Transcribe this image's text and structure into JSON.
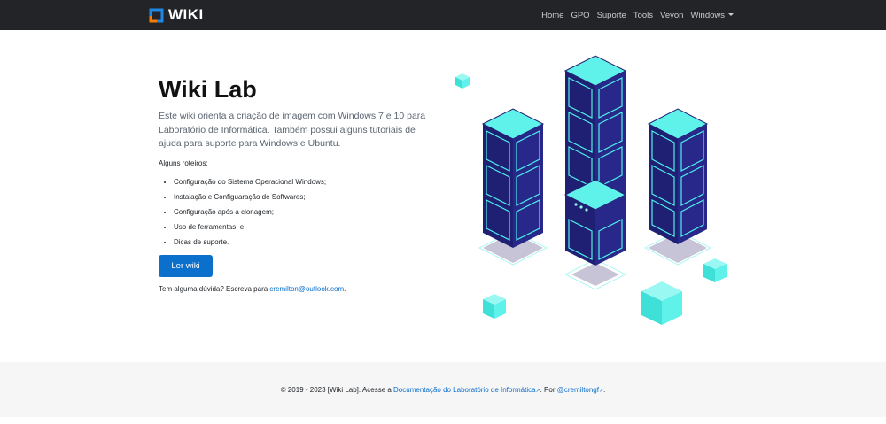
{
  "navbar": {
    "brand": "WIKI",
    "links": [
      "Home",
      "GPO",
      "Suporte",
      "Tools",
      "Veyon",
      "Windows"
    ]
  },
  "hero": {
    "title": "Wiki Lab",
    "lead": "Este wiki orienta a criação de imagem com Windows 7 e 10 para Laboratório de Informática. Também possui alguns tutoriais de ajuda para suporte para Windows e Ubuntu.",
    "list_title": "Alguns roteiros:",
    "items": [
      "Configuração do Sistema Operacional Windows;",
      "Instalação e Configuaração de Softwares;",
      "Configuração após a clonagem;",
      "Uso de ferramentas; e",
      "Dicas de suporte."
    ],
    "button": "Ler wiki",
    "contact_prefix": "Tem alguma dúvida? Escreva para ",
    "contact_email": "cremilton@outlook.com",
    "contact_suffix": "."
  },
  "footer": {
    "prefix": "© 2019 - 2023 [Wiki Lab]. Acesse a ",
    "link1": "Documentação do Laboratório de Informática",
    "middle": ". Por ",
    "link2": "@cremiltongf",
    "suffix": "."
  },
  "colors": {
    "navbar": "#222427",
    "primary": "#0b6fcc",
    "cube_cyan": "#5ff2ea",
    "tower_navy": "#1f1f73"
  }
}
